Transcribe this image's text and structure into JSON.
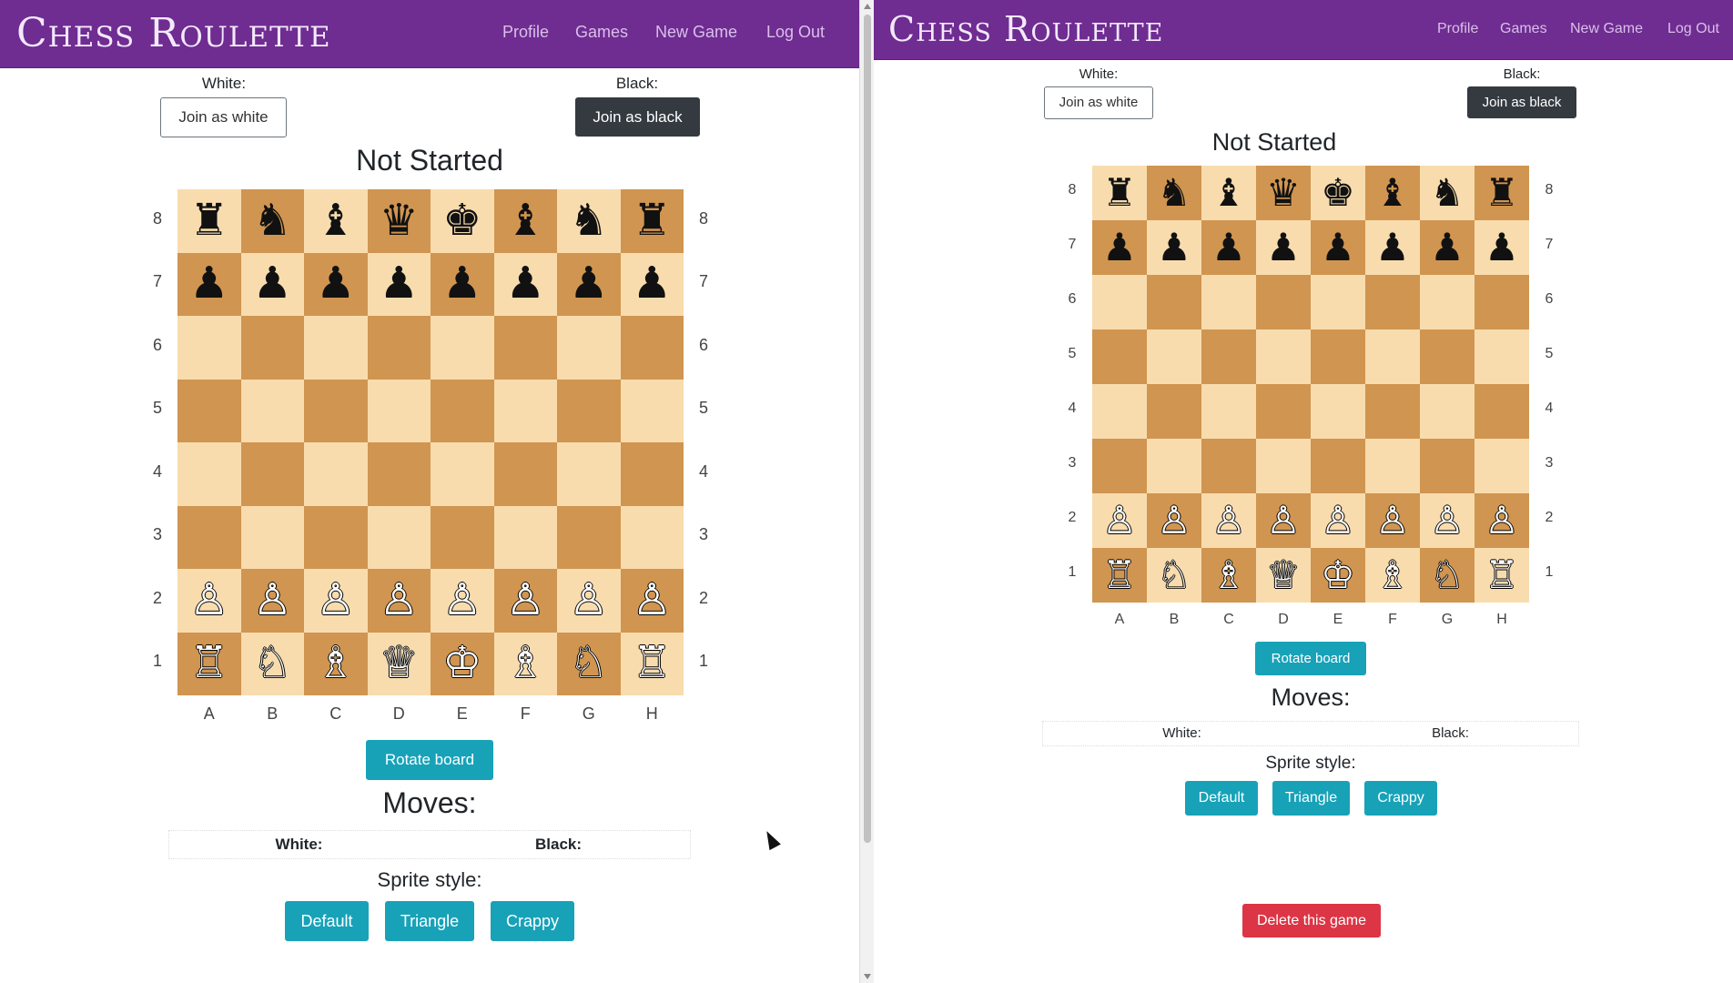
{
  "app": {
    "brand": "Chess Roulette",
    "nav": [
      "Profile",
      "Games",
      "New Game",
      "Log Out"
    ]
  },
  "game": {
    "white_label": "White:",
    "black_label": "Black:",
    "join_white": "Join as white",
    "join_black": "Join as black",
    "status": "Not Started",
    "rotate": "Rotate board",
    "moves_title": "Moves:",
    "moves_white": "White:",
    "moves_black": "Black:",
    "sprite_title": "Sprite style:",
    "sprites": [
      "Default",
      "Triangle",
      "Crappy"
    ],
    "delete": "Delete this game"
  },
  "board": {
    "files": [
      "A",
      "B",
      "C",
      "D",
      "E",
      "F",
      "G",
      "H"
    ],
    "ranks": [
      "8",
      "7",
      "6",
      "5",
      "4",
      "3",
      "2",
      "1"
    ],
    "rows": [
      [
        "♜",
        "♞",
        "♝",
        "♛",
        "♚",
        "♝",
        "♞",
        "♜"
      ],
      [
        "♟",
        "♟",
        "♟",
        "♟",
        "♟",
        "♟",
        "♟",
        "♟"
      ],
      [
        "",
        "",
        "",
        "",
        "",
        "",
        "",
        ""
      ],
      [
        "",
        "",
        "",
        "",
        "",
        "",
        "",
        ""
      ],
      [
        "",
        "",
        "",
        "",
        "",
        "",
        "",
        ""
      ],
      [
        "",
        "",
        "",
        "",
        "",
        "",
        "",
        ""
      ],
      [
        "♙",
        "♙",
        "♙",
        "♙",
        "♙",
        "♙",
        "♙",
        "♙"
      ],
      [
        "♖",
        "♘",
        "♗",
        "♕",
        "♔",
        "♗",
        "♘",
        "♖"
      ]
    ],
    "colors": {
      "light": "#f8dcae",
      "dark": "#d09550"
    }
  },
  "theme": {
    "navbar": "#6f2c91",
    "teal": "#17a2b8",
    "danger": "#dc3545",
    "dark": "#343a40"
  }
}
